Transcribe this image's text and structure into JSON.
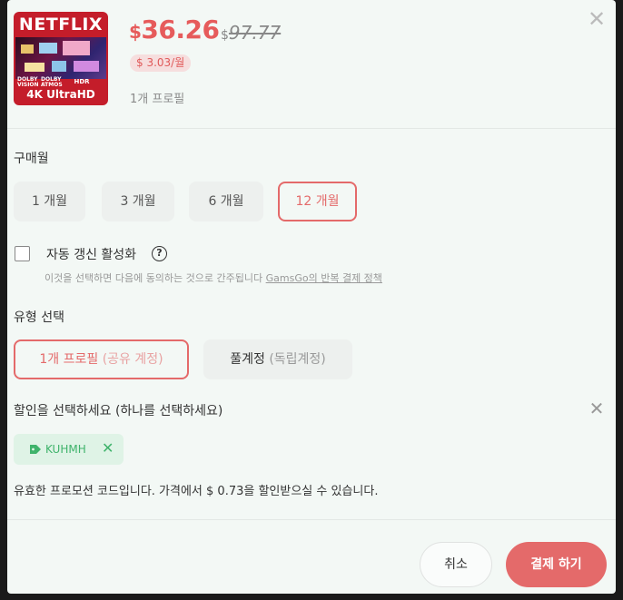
{
  "product": {
    "brand_text": "NETFLIX",
    "badges": [
      "DOLBY VISION",
      "DOLBY ATMOS",
      "HDR"
    ],
    "quality_text": "4K UltraHD",
    "currency": "$",
    "price": "36.26",
    "original_price": "97.77",
    "monthly_price": "$ 3.03/월",
    "profile_info": "1개 프로필"
  },
  "purchase_months": {
    "label": "구매월",
    "options": [
      {
        "label": "1 개월",
        "selected": false
      },
      {
        "label": "3 개월",
        "selected": false
      },
      {
        "label": "6 개월",
        "selected": false
      },
      {
        "label": "12 개월",
        "selected": true
      }
    ]
  },
  "auto_renew": {
    "label": "자동 갱신 활성화",
    "checked": false,
    "help_icon": "?",
    "terms_text": "이것을 선택하면 다음에 동의하는 것으로 간주됩니다",
    "terms_link": "GamsGo의 반복 결제 정책"
  },
  "account_type": {
    "label": "유형 선택",
    "options": [
      {
        "main": "1개 프로필",
        "sub": "(공유 계정)",
        "selected": true
      },
      {
        "main": "풀계정",
        "sub": "(독립계정)",
        "selected": false
      }
    ]
  },
  "discount": {
    "label": "할인을 선택하세요 (하나를 선택하세요)",
    "coupon_code": "KUHMH",
    "valid_message": "유효한 프로모션 코드입니다. 가격에서 $ 0.73을 할인받으실 수 있습니다."
  },
  "actions": {
    "cancel_label": "취소",
    "pay_label": "결제 하기"
  },
  "colors": {
    "accent": "#e46a6a",
    "coupon_green": "#3fb36b",
    "background": "#f3f8f5"
  }
}
